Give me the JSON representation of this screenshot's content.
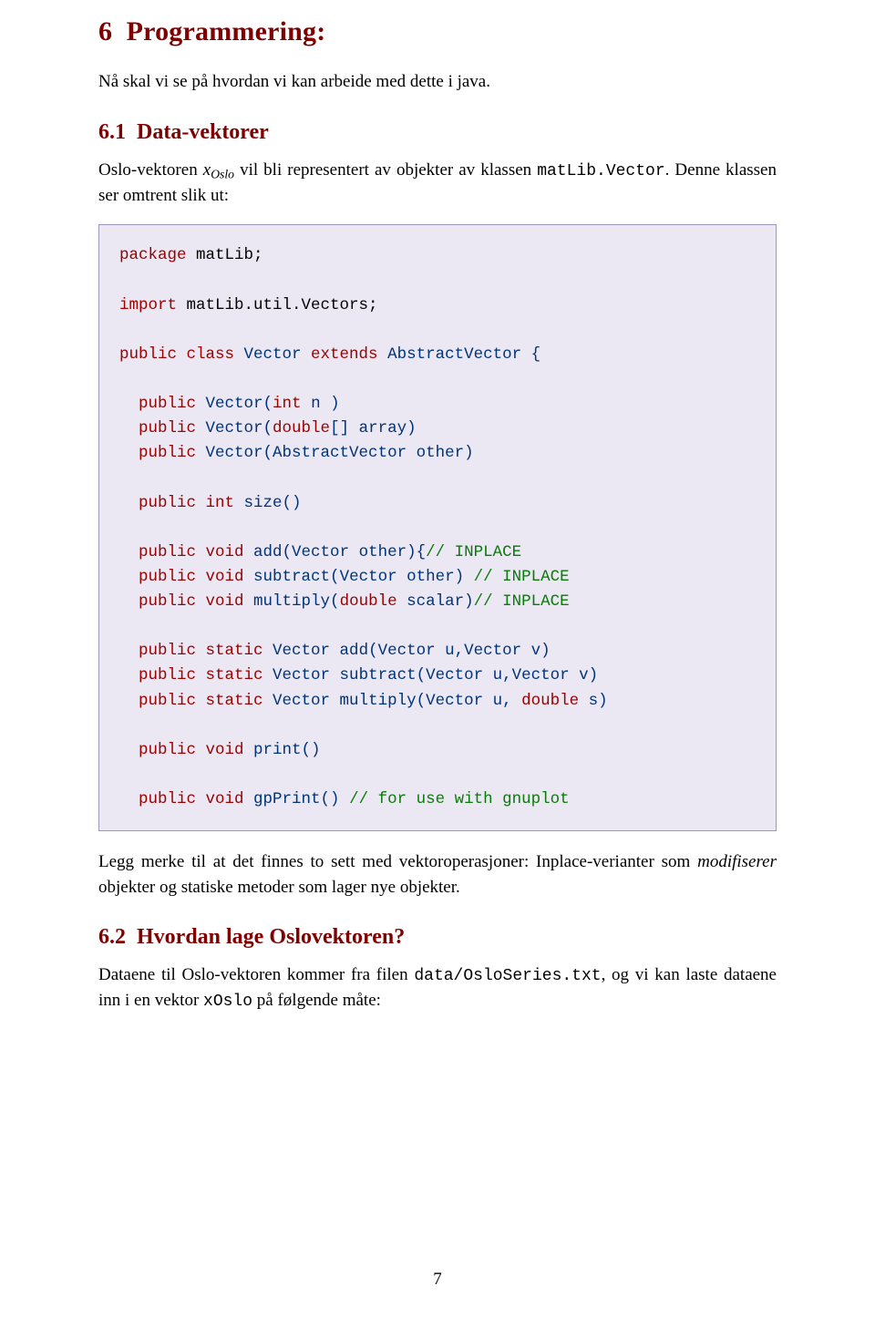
{
  "section": {
    "number": "6",
    "title": "Programmering:"
  },
  "intro": "Nå skal vi se på hvordan vi kan arbeide med dette i java.",
  "sub61": {
    "number": "6.1",
    "title": "Data-vektorer",
    "para_pre": "Oslo-vektoren ",
    "para_var": "x",
    "para_sub": "Oslo",
    "para_mid": " vil bli representert av objekter av klassen ",
    "para_code": "matLib.Vector",
    "para_post": ". Denne klassen ser omtrent slik ut:"
  },
  "code": {
    "l01a": "package",
    "l01b": " matLib;",
    "l03a": "import",
    "l03b": " matLib.util.Vectors;",
    "l05a": "public class",
    "l05b": " Vector ",
    "l05c": "extends",
    "l05d": " AbstractVector {",
    "l07a": "public",
    "l07b": " Vector(",
    "l07c": "int",
    "l07d": " n )",
    "l08a": "public",
    "l08b": " Vector(",
    "l08c": "double",
    "l08d": "[] array)",
    "l09a": "public",
    "l09b": " Vector(AbstractVector other)",
    "l11a": "public int",
    "l11b": " size()",
    "l13a": "public void",
    "l13b": " add(Vector other){",
    "l13c": "// INPLACE",
    "l14a": "public void",
    "l14b": " subtract(Vector other) ",
    "l14c": "// INPLACE",
    "l15a": "public void",
    "l15b": " multiply(",
    "l15c": "double",
    "l15d": " scalar)",
    "l15e": "// INPLACE",
    "l17a": "public static",
    "l17b": " Vector add(Vector u,Vector v)",
    "l18a": "public static",
    "l18b": " Vector subtract(Vector u,Vector v)",
    "l19a": "public static",
    "l19b": " Vector multiply(Vector u, ",
    "l19c": "double",
    "l19d": " s)",
    "l21a": "public void",
    "l21b": " print()",
    "l23a": "public void",
    "l23b": " gpPrint() ",
    "l23c": "// for use with gnuplot"
  },
  "after61_a": "Legg merke til at det finnes to sett med vektoroperasjoner: Inplace-verianter som ",
  "after61_em": "modifiserer",
  "after61_b": " objekter og statiske metoder som lager nye objekter.",
  "sub62": {
    "number": "6.2",
    "title": "Hvordan lage Oslovektoren?",
    "para_a": "Dataene til Oslo-vektoren kommer fra filen ",
    "para_code1": "data/OsloSeries.txt",
    "para_b": ", og vi kan laste dataene inn i en vektor ",
    "para_code2": "xOslo",
    "para_c": " på følgende måte:"
  },
  "page_number": "7"
}
